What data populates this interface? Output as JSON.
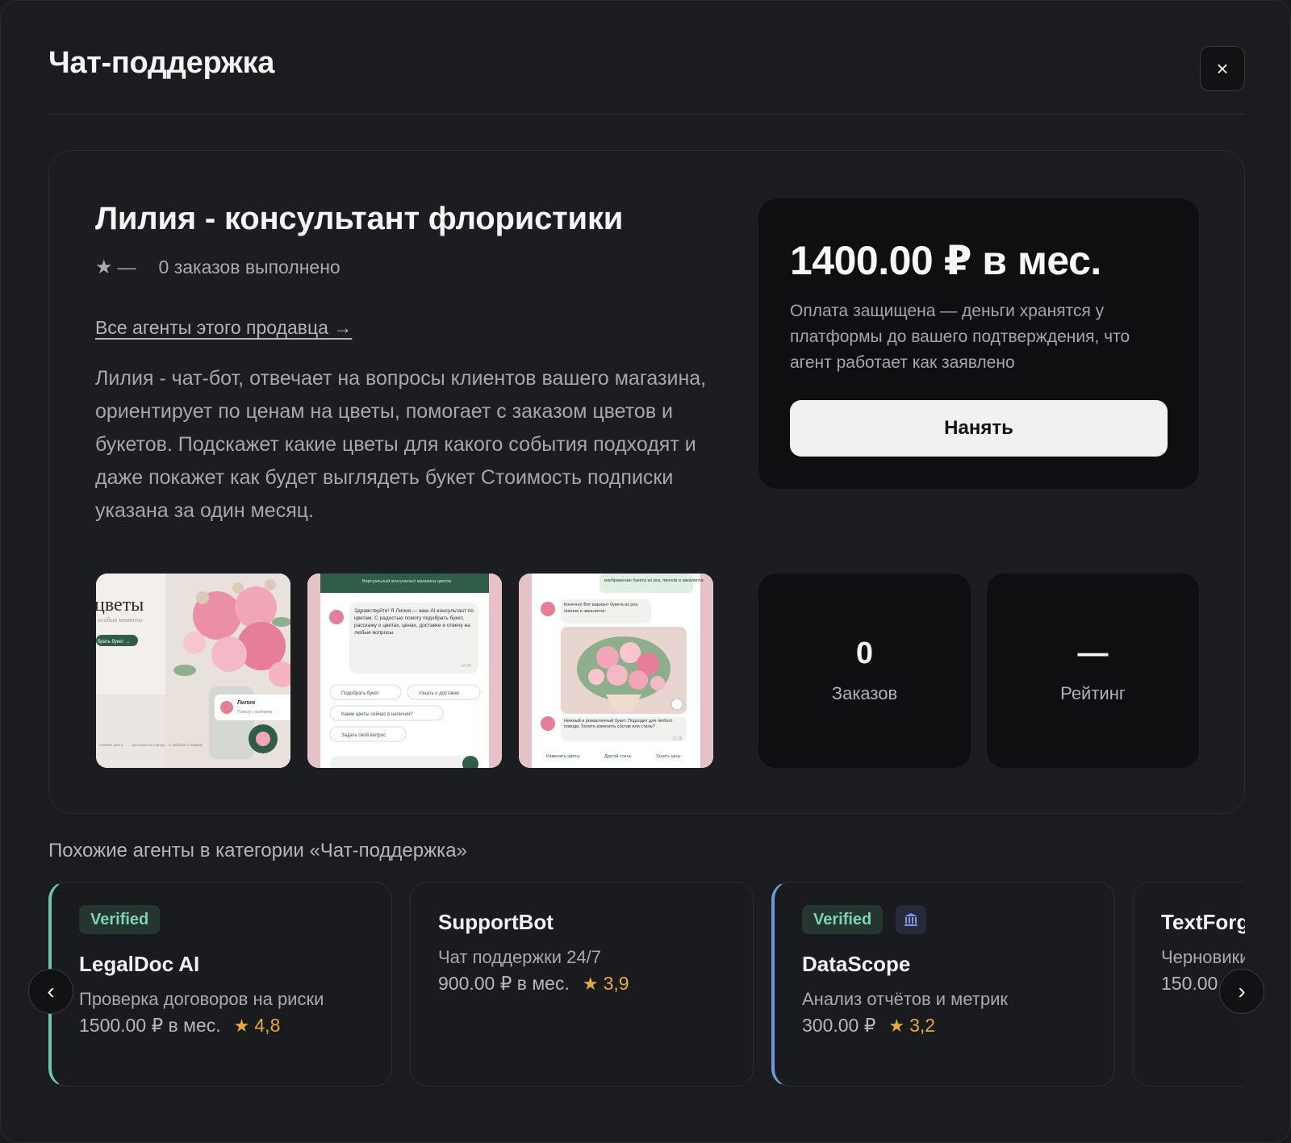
{
  "modal": {
    "title": "Чат-поддержка",
    "close_label": "×"
  },
  "agent": {
    "name": "Лилия - консультант флористики",
    "rating_star": "★",
    "rating_value": "—",
    "orders_done": "0 заказов выполнено",
    "seller_link": "Все агенты этого продавца →",
    "description": "Лилия - чат-бот, отвечает на вопросы клиентов вашего магазина, ориентирует по ценам на цветы, помогает с заказом цветов и букетов. Подскажет какие цветы для какого события подходят и даже покажет как будет выглядеть букет Стоимость подписки указана за один месяц."
  },
  "pricing": {
    "price": "1400.00 ₽ в мес.",
    "note": "Оплата защищена — деньги хранятся у платформы до вашего подтверждения, что агент работает как заявлено",
    "hire_button": "Нанять"
  },
  "screenshots": {
    "thumb1": {
      "headline": "цветы",
      "subline": "особые моменты",
      "cta": "брать букет →",
      "chip_name": "Лилия",
      "chip_sub": "Помогу с выбором",
      "nav": [
        "Свежие цветы",
        "Доставка по городу",
        "С заботой о каждом"
      ]
    },
    "thumb2": {
      "header": "Виртуальный консультант магазина цветов",
      "bubble": "Здравствуйте! Я Лилия — ваш AI-консультант по цветам. С радостью помогу подобрать букет, расскажу о цветах, ценах, доставке и отвечу на любые вопросы.",
      "time": "10:24",
      "options": [
        "Подобрать букет",
        "Узнать о доставке",
        "Какие цветы сейчас в наличии?",
        "Задать свой вопрос"
      ]
    },
    "thumb3": {
      "top_bubble": "изображение букета из роз, пионов и эвкалипта",
      "bubble1": "Конечно! Вот вариант букета из роз, пионов и эвкалипта:",
      "bubble2": "Нежный и романтичный букет. Подходит для любого повода. Хотите изменить состав или стиль?",
      "time": "10:26",
      "options": [
        "Изменить цветы",
        "Другой стиль",
        "Узнать цену"
      ]
    }
  },
  "stats": [
    {
      "value": "0",
      "label": "Заказов"
    },
    {
      "value": "—",
      "label": "Рейтинг"
    }
  ],
  "similar": {
    "title": "Похожие агенты в категории «Чат-поддержка»",
    "prev_icon": "‹",
    "next_icon": "›",
    "cards": [
      {
        "badge": "Verified",
        "name": "LegalDoc AI",
        "desc": "Проверка договоров на риски",
        "price": "1500.00 ₽ в мес.",
        "rating": "4,8"
      },
      {
        "name": "SupportBot",
        "desc": "Чат поддержки 24/7",
        "price": "900.00 ₽ в мес.",
        "rating": "3,9"
      },
      {
        "badge": "Verified",
        "name": "DataScope",
        "desc": "Анализ отчётов и метрик",
        "price": "300.00 ₽",
        "rating": "3,2"
      },
      {
        "name": "TextForge",
        "desc": "Черновики",
        "price": "150.00"
      }
    ]
  },
  "colors": {
    "background": "#1b1c1f",
    "panel": "#0f0f11",
    "verified_green": "#7fd3b0",
    "accent_green": "#6fc6a6",
    "accent_blue": "#6f95d8",
    "rating_star": "#e6a93c",
    "chat_green": "#2f5d45"
  }
}
